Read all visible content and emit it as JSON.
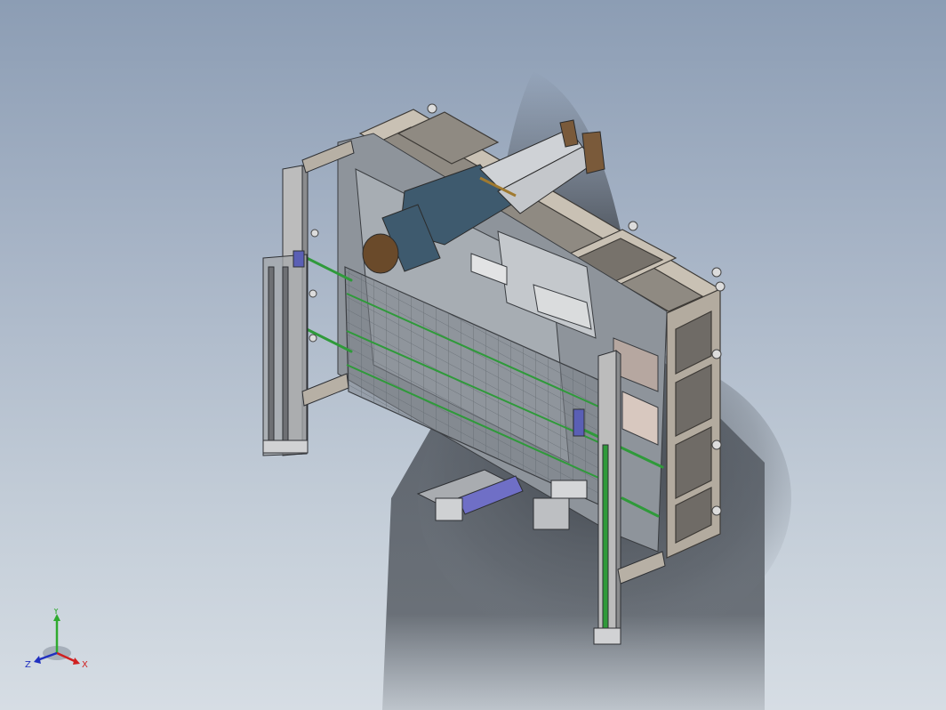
{
  "viewport": {
    "background_top": "#8c9db4",
    "background_bottom": "#d6dde4"
  },
  "model": {
    "frame_color": "#b8b0a4",
    "panel_color": "#9aa0a6",
    "belt_color": "#2f9a3a",
    "accent_blue": "#6e6fc4",
    "figure_shirt": "#3e5a6e",
    "figure_pants": "#cfd2d6",
    "figure_hair": "#6a4a2a"
  },
  "triad": {
    "y_label": "Y",
    "x_label": "X",
    "z_label": "Z",
    "y_color": "#2faa2f",
    "x_color": "#d02020",
    "z_color": "#2030c0"
  }
}
